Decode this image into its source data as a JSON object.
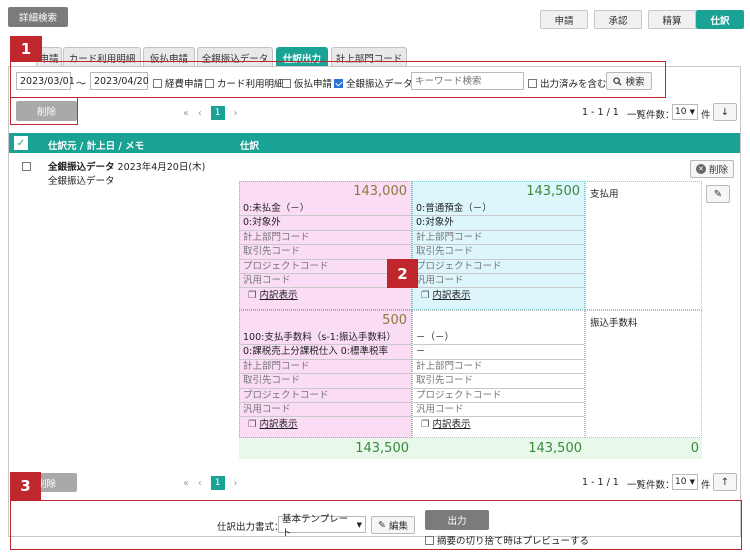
{
  "top": {
    "detail_search": "詳細検索",
    "nav": [
      "申請",
      "承認",
      "精算",
      "仕訳"
    ]
  },
  "tabs": [
    "申請",
    "カード利用明細",
    "仮払申請",
    "全銀振込データ",
    "仕訳出力",
    "計上部門コード"
  ],
  "markers": [
    "1",
    "2",
    "3"
  ],
  "filter": {
    "date_from": "2023/03/01",
    "tilde": "～",
    "date_to": "2023/04/20",
    "checks": [
      {
        "label": "経費申請",
        "checked": false
      },
      {
        "label": "カード利用明細",
        "checked": false
      },
      {
        "label": "仮払申請",
        "checked": false
      },
      {
        "label": "全銀振込データ",
        "checked": true
      }
    ],
    "keyword_placeholder": "キーワード検索",
    "output_done": "出力済みを含む",
    "search": "検索"
  },
  "delete_label": "削除",
  "pagination": {
    "prev2": "«",
    "prev": "‹",
    "page": "1",
    "next": "›",
    "range": "1 - 1 / 1",
    "per_page_label": "一覧件数：",
    "per_page": "10",
    "unit": "件"
  },
  "table": {
    "header_source": "仕訳元 / 計上日 / メモ",
    "header_journal": "仕訳"
  },
  "record": {
    "title": "全銀振込データ",
    "date": "2023年4月20日(木)",
    "memo": "全銀振込データ",
    "delete": "削除"
  },
  "entries": [
    {
      "debit": {
        "amount": "143,000",
        "lines": [
          "0:未払金（－）",
          "0:対象外"
        ],
        "dims": [
          "計上部門コード",
          "取引先コード",
          "プロジェクトコード",
          "汎用コード"
        ],
        "link": "内訳表示"
      },
      "credit": {
        "amount": "143,500",
        "lines": [
          "0:普通預金（－）",
          "0:対象外"
        ],
        "dims": [
          "計上部門コード",
          "取引先コード",
          "プロジェクトコード",
          "汎用コード"
        ],
        "link": "内訳表示"
      },
      "memo": "支払用"
    },
    {
      "debit": {
        "amount": "500",
        "lines": [
          "100:支払手数料（s-1:振込手数料）",
          "0:課税売上分課税仕入 0:標準税率"
        ],
        "dims": [
          "計上部門コード",
          "取引先コード",
          "プロジェクトコード",
          "汎用コード"
        ],
        "link": "内訳表示"
      },
      "credit": {
        "amount": "",
        "lines": [
          "－（－）",
          "－"
        ],
        "dims": [
          "計上部門コード",
          "取引先コード",
          "プロジェクトコード",
          "汎用コード"
        ],
        "link": "内訳表示"
      },
      "memo": "振込手数料"
    }
  ],
  "totals": [
    "143,500",
    "143,500",
    "0"
  ],
  "output": {
    "format_label": "仕訳出力書式：",
    "format_value": "基本テンプレート",
    "edit": "編集",
    "output_btn": "出力",
    "preview_label": "摘要の切り捨て時はプレビューする"
  },
  "colors": {
    "accent": "#1aa295",
    "marker": "#c0272d",
    "debit_bg": "#fbdcf5",
    "credit_bg": "#dcf6fc",
    "total_bg": "#e8f8ea"
  }
}
